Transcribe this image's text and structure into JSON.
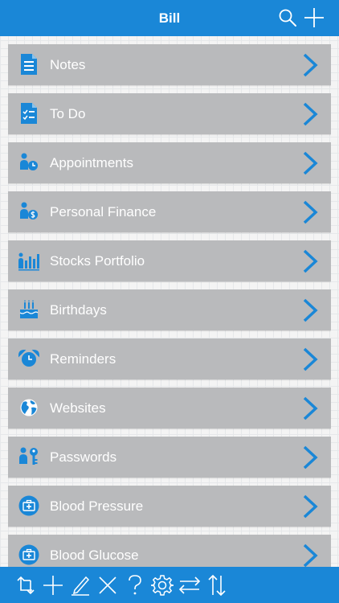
{
  "header": {
    "title": "Bill",
    "search_icon": "search-icon",
    "add_icon": "plus-icon"
  },
  "colors": {
    "accent": "#1a87d7",
    "row_background": "#b9babc",
    "row_text": "#ffffff",
    "page_background": "#f4f4f4"
  },
  "list": {
    "items": [
      {
        "label": "Notes",
        "icon": "notes-document-icon"
      },
      {
        "label": "To Do",
        "icon": "checklist-icon"
      },
      {
        "label": "Appointments",
        "icon": "person-clock-icon"
      },
      {
        "label": "Personal Finance",
        "icon": "person-dollar-icon"
      },
      {
        "label": "Stocks Portfolio",
        "icon": "person-bar-chart-icon"
      },
      {
        "label": "Birthdays",
        "icon": "birthday-cake-icon"
      },
      {
        "label": "Reminders",
        "icon": "alarm-clock-icon"
      },
      {
        "label": "Websites",
        "icon": "globe-icon"
      },
      {
        "label": "Passwords",
        "icon": "person-key-icon"
      },
      {
        "label": "Blood Pressure",
        "icon": "medical-kit-icon"
      },
      {
        "label": "Blood Glucose",
        "icon": "medical-kit-icon"
      }
    ]
  },
  "toolbar": {
    "items": [
      {
        "icon": "rotate-icon"
      },
      {
        "icon": "plus-icon"
      },
      {
        "icon": "pencil-icon"
      },
      {
        "icon": "close-icon"
      },
      {
        "icon": "help-icon"
      },
      {
        "icon": "gear-icon"
      },
      {
        "icon": "swap-horizontal-icon"
      },
      {
        "icon": "swap-vertical-icon"
      }
    ]
  }
}
